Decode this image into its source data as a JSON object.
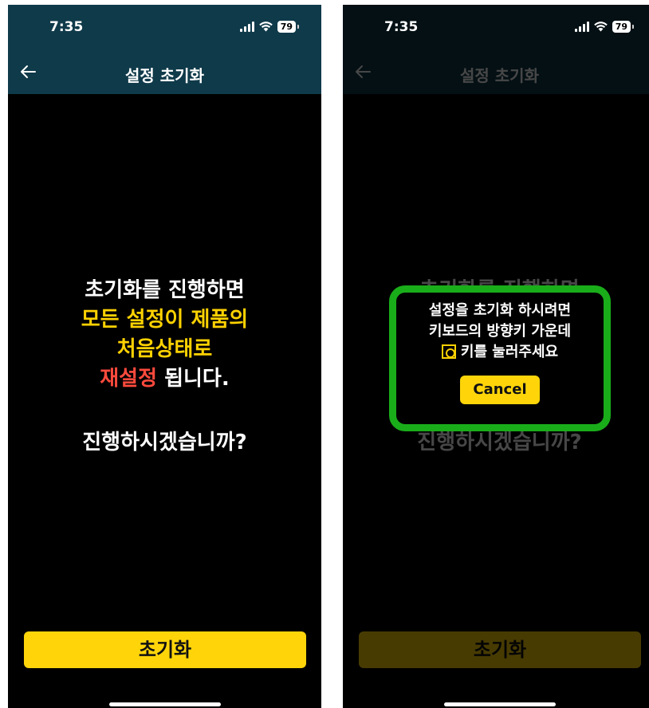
{
  "status_bar": {
    "time": "7:35",
    "battery": "79"
  },
  "header": {
    "title": "설정 초기화"
  },
  "message": {
    "line1": "초기화를 진행하면",
    "line2": "모든 설정이 제품의",
    "line3": "처음상태로",
    "line4_highlight": "재설정",
    "line4_rest": " 됩니다.",
    "question": "진행하시겠습니까?"
  },
  "reset_button": {
    "label": "초기화"
  },
  "dialog": {
    "line1": "설정을 초기화 하시려면",
    "line2": "키보드의 방향키 가운데",
    "line3": "키를 눌러주세요",
    "cancel_label": "Cancel"
  },
  "colors": {
    "header_bg": "#0f3a4a",
    "accent_yellow": "#ffd200",
    "accent_red": "#ff4a3d",
    "dialog_border": "#1aad1a"
  }
}
